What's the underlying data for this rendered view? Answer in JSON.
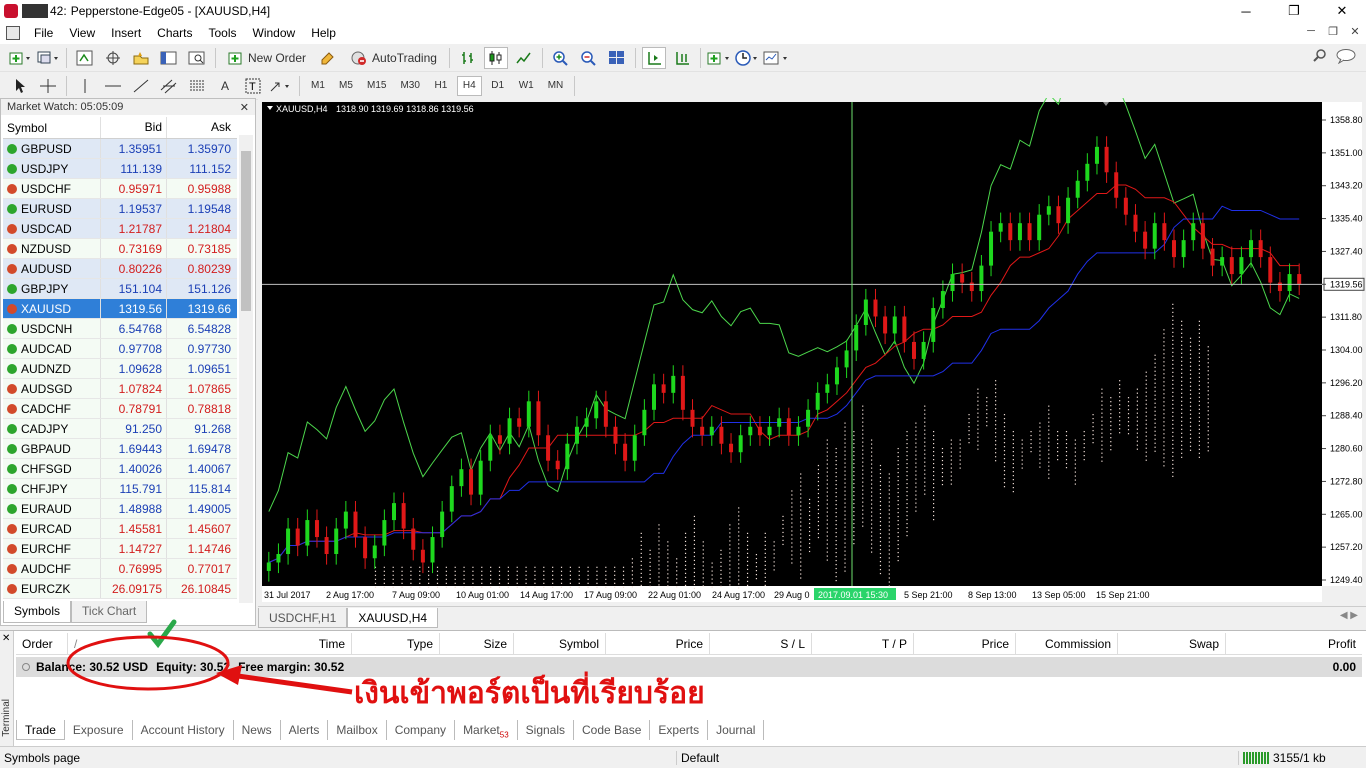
{
  "window": {
    "title_prefix": "42:",
    "title": "Pepperstone-Edge05 - [XAUUSD,H4]",
    "controls": [
      "─",
      "❐",
      "✕"
    ]
  },
  "menu": [
    "File",
    "View",
    "Insert",
    "Charts",
    "Tools",
    "Window",
    "Help"
  ],
  "toolbar": {
    "new_order": "New Order",
    "autotrading": "AutoTrading",
    "timeframes": [
      "M1",
      "M5",
      "M15",
      "M30",
      "H1",
      "H4",
      "D1",
      "W1",
      "MN"
    ],
    "active_timeframe": "H4"
  },
  "market_watch": {
    "title": "Market Watch: 05:05:09",
    "columns": [
      "Symbol",
      "Bid",
      "Ask"
    ],
    "rows": [
      {
        "symbol": "GBPUSD",
        "bid": "1.35951",
        "ask": "1.35970",
        "dir": "up",
        "color": "blue",
        "style": "alt"
      },
      {
        "symbol": "USDJPY",
        "bid": "111.139",
        "ask": "111.152",
        "dir": "up",
        "color": "blue",
        "style": "alt"
      },
      {
        "symbol": "USDCHF",
        "bid": "0.95971",
        "ask": "0.95988",
        "dir": "down",
        "color": "red",
        "style": "plain"
      },
      {
        "symbol": "EURUSD",
        "bid": "1.19537",
        "ask": "1.19548",
        "dir": "up",
        "color": "blue",
        "style": "alt"
      },
      {
        "symbol": "USDCAD",
        "bid": "1.21787",
        "ask": "1.21804",
        "dir": "down",
        "color": "red",
        "style": "alt"
      },
      {
        "symbol": "NZDUSD",
        "bid": "0.73169",
        "ask": "0.73185",
        "dir": "down",
        "color": "red",
        "style": "plain"
      },
      {
        "symbol": "AUDUSD",
        "bid": "0.80226",
        "ask": "0.80239",
        "dir": "down",
        "color": "red",
        "style": "alt"
      },
      {
        "symbol": "GBPJPY",
        "bid": "151.104",
        "ask": "151.126",
        "dir": "up",
        "color": "blue",
        "style": "alt"
      },
      {
        "symbol": "XAUUSD",
        "bid": "1319.56",
        "ask": "1319.66",
        "dir": "down",
        "color": "blue",
        "style": "sel"
      },
      {
        "symbol": "USDCNH",
        "bid": "6.54768",
        "ask": "6.54828",
        "dir": "up",
        "color": "blue",
        "style": "plain"
      },
      {
        "symbol": "AUDCAD",
        "bid": "0.97708",
        "ask": "0.97730",
        "dir": "up",
        "color": "blue",
        "style": "plain"
      },
      {
        "symbol": "AUDNZD",
        "bid": "1.09628",
        "ask": "1.09651",
        "dir": "up",
        "color": "blue",
        "style": "plain"
      },
      {
        "symbol": "AUDSGD",
        "bid": "1.07824",
        "ask": "1.07865",
        "dir": "down",
        "color": "red",
        "style": "plain"
      },
      {
        "symbol": "CADCHF",
        "bid": "0.78791",
        "ask": "0.78818",
        "dir": "down",
        "color": "red",
        "style": "plain"
      },
      {
        "symbol": "CADJPY",
        "bid": "91.250",
        "ask": "91.268",
        "dir": "up",
        "color": "blue",
        "style": "plain"
      },
      {
        "symbol": "GBPAUD",
        "bid": "1.69443",
        "ask": "1.69478",
        "dir": "up",
        "color": "blue",
        "style": "plain"
      },
      {
        "symbol": "CHFSGD",
        "bid": "1.40026",
        "ask": "1.40067",
        "dir": "up",
        "color": "blue",
        "style": "plain"
      },
      {
        "symbol": "CHFJPY",
        "bid": "115.791",
        "ask": "115.814",
        "dir": "up",
        "color": "blue",
        "style": "plain"
      },
      {
        "symbol": "EURAUD",
        "bid": "1.48988",
        "ask": "1.49005",
        "dir": "up",
        "color": "blue",
        "style": "plain"
      },
      {
        "symbol": "EURCAD",
        "bid": "1.45581",
        "ask": "1.45607",
        "dir": "down",
        "color": "red",
        "style": "plain"
      },
      {
        "symbol": "EURCHF",
        "bid": "1.14727",
        "ask": "1.14746",
        "dir": "down",
        "color": "red",
        "style": "plain"
      },
      {
        "symbol": "AUDCHF",
        "bid": "0.76995",
        "ask": "0.77017",
        "dir": "down",
        "color": "red",
        "style": "plain"
      },
      {
        "symbol": "EURCZK",
        "bid": "26.09175",
        "ask": "26.10845",
        "dir": "down",
        "color": "red",
        "style": "plain"
      }
    ],
    "tabs": [
      "Symbols",
      "Tick Chart"
    ]
  },
  "chart_data": {
    "type": "candlestick",
    "symbol_header": "XAUUSD,H4",
    "ohlc_header": "1318.90 1319.69 1318.86 1319.56",
    "current_price": "1319.56",
    "y_ticks": [
      "1358.80",
      "1351.00",
      "1343.20",
      "1335.40",
      "1327.40",
      "1319.56",
      "1311.80",
      "1304.00",
      "1296.20",
      "1288.40",
      "1280.60",
      "1272.80",
      "1265.00",
      "1257.20",
      "1249.40"
    ],
    "ylim": [
      1249.4,
      1358.8
    ],
    "x_ticks": [
      "31 Jul 2017",
      "2 Aug 17:00",
      "7 Aug 09:00",
      "10 Aug 01:00",
      "14 Aug 17:00",
      "17 Aug 09:00",
      "22 Aug 01:00",
      "24 Aug 17:00",
      "29 Aug 0",
      "5 Sep 21:00",
      "8 Sep 13:00",
      "13 Sep 05:00",
      "15 Sep 21:00"
    ],
    "crosshair_label": "2017.09.01 15:30",
    "colors": {
      "background": "#000000",
      "bull": "#1ed81e",
      "bear": "#e01818",
      "chikou": "#4cd64c",
      "tenkan": "#e01818",
      "kijun": "#2030e8",
      "cloud": "#f2e0d8",
      "crosshair": "#6ee06e"
    },
    "close_series": [
      1254,
      1256,
      1262,
      1258,
      1264,
      1260,
      1256,
      1262,
      1266,
      1260,
      1255,
      1258,
      1264,
      1268,
      1262,
      1257,
      1254,
      1260,
      1266,
      1272,
      1276,
      1270,
      1278,
      1284,
      1282,
      1288,
      1286,
      1292,
      1284,
      1278,
      1276,
      1282,
      1286,
      1288,
      1292,
      1286,
      1282,
      1278,
      1284,
      1290,
      1296,
      1294,
      1298,
      1290,
      1286,
      1284,
      1286,
      1282,
      1280,
      1284,
      1286,
      1284,
      1286,
      1288,
      1284,
      1286,
      1290,
      1294,
      1296,
      1300,
      1304,
      1310,
      1316,
      1312,
      1308,
      1312,
      1306,
      1302,
      1306,
      1314,
      1318,
      1322,
      1320,
      1318,
      1324,
      1332,
      1334,
      1330,
      1334,
      1330,
      1336,
      1338,
      1334,
      1340,
      1344,
      1348,
      1352,
      1346,
      1340,
      1336,
      1332,
      1328,
      1334,
      1330,
      1326,
      1330,
      1334,
      1328,
      1324,
      1326,
      1322,
      1326,
      1330,
      1326,
      1320,
      1318,
      1322,
      1319.56
    ]
  },
  "chart_tabs": [
    "USDCHF,H1",
    "XAUUSD,H4"
  ],
  "terminal": {
    "side_label": "Terminal",
    "columns": [
      "Order",
      "/",
      "Time",
      "Type",
      "Size",
      "Symbol",
      "Price",
      "S / L",
      "T / P",
      "Price",
      "Commission",
      "Swap",
      "Profit"
    ],
    "balance": "Balance: 30.52 USD",
    "equity": "Equity: 30.52",
    "free_margin": "Free margin: 30.52",
    "profit": "0.00",
    "tabs": [
      "Trade",
      "Exposure",
      "Account History",
      "News",
      "Alerts",
      "Mailbox",
      "Company",
      "Market",
      "Signals",
      "Code Base",
      "Experts",
      "Journal"
    ],
    "market_badge": "53"
  },
  "annotation": {
    "text": "เงินเข้าพอร์ตเป็นที่เรียบร้อย",
    "color": "#e01010"
  },
  "status": {
    "left": "Symbols page",
    "mid": "Default",
    "right": "3155/1 kb"
  }
}
